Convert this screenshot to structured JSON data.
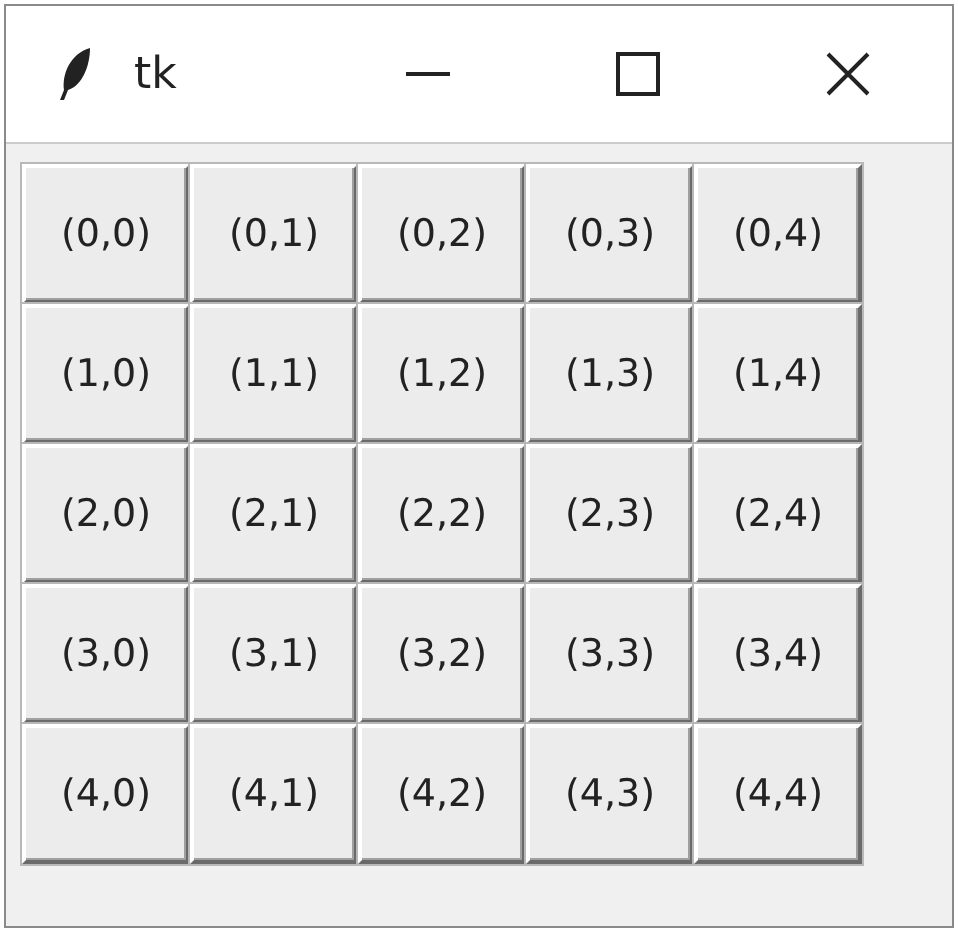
{
  "window": {
    "title": "tk"
  },
  "grid": [
    [
      "(0,0)",
      "(0,1)",
      "(0,2)",
      "(0,3)",
      "(0,4)"
    ],
    [
      "(1,0)",
      "(1,1)",
      "(1,2)",
      "(1,3)",
      "(1,4)"
    ],
    [
      "(2,0)",
      "(2,1)",
      "(2,2)",
      "(2,3)",
      "(2,4)"
    ],
    [
      "(3,0)",
      "(3,1)",
      "(3,2)",
      "(3,3)",
      "(3,4)"
    ],
    [
      "(4,0)",
      "(4,1)",
      "(4,2)",
      "(4,3)",
      "(4,4)"
    ]
  ]
}
